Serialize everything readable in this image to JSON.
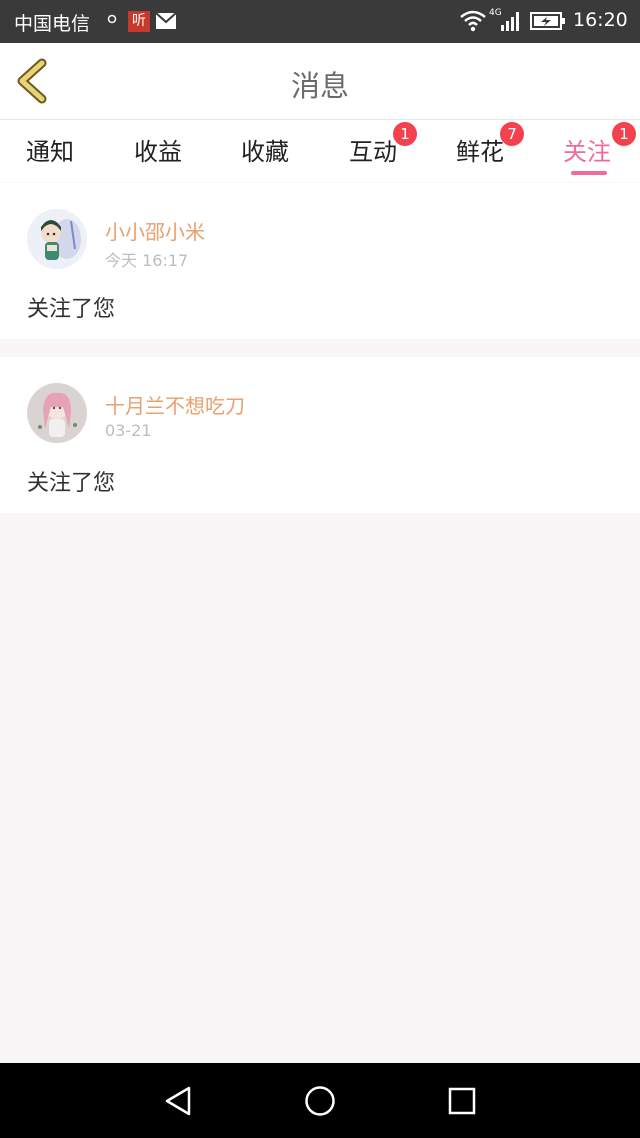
{
  "status_bar": {
    "carrier": "中国电信",
    "ting_label": "听",
    "network": "4G",
    "time": "16:20",
    "icons": [
      "notification-dot-icon",
      "ting-app-icon",
      "mail-icon",
      "wifi-icon",
      "signal-icon",
      "battery-charging-icon"
    ]
  },
  "header": {
    "title": "消息",
    "back_icon": "chevron-left-icon"
  },
  "tabs": [
    {
      "label": "通知",
      "badge": null,
      "active": false
    },
    {
      "label": "收益",
      "badge": null,
      "active": false
    },
    {
      "label": "收藏",
      "badge": null,
      "active": false
    },
    {
      "label": "互动",
      "badge": "1",
      "active": false
    },
    {
      "label": "鲜花",
      "badge": "7",
      "active": false
    },
    {
      "label": "关注",
      "badge": "1",
      "active": true
    }
  ],
  "notifications": [
    {
      "username": "小小邵小米",
      "time": "今天 16:17",
      "message": "关注了您",
      "avatar": "anime-girl-avatar"
    },
    {
      "username": "十月兰不想吃刀",
      "time": "03-21",
      "message": "关注了您",
      "avatar": "pink-hair-girl-avatar"
    }
  ],
  "colors": {
    "accent": "#f06a9a",
    "username": "#e9a06f",
    "badge": "#f2414f",
    "back_arrow": "#e8d27a"
  },
  "nav_bar": {
    "icons": [
      "back-triangle-icon",
      "home-circle-icon",
      "recents-square-icon"
    ]
  }
}
